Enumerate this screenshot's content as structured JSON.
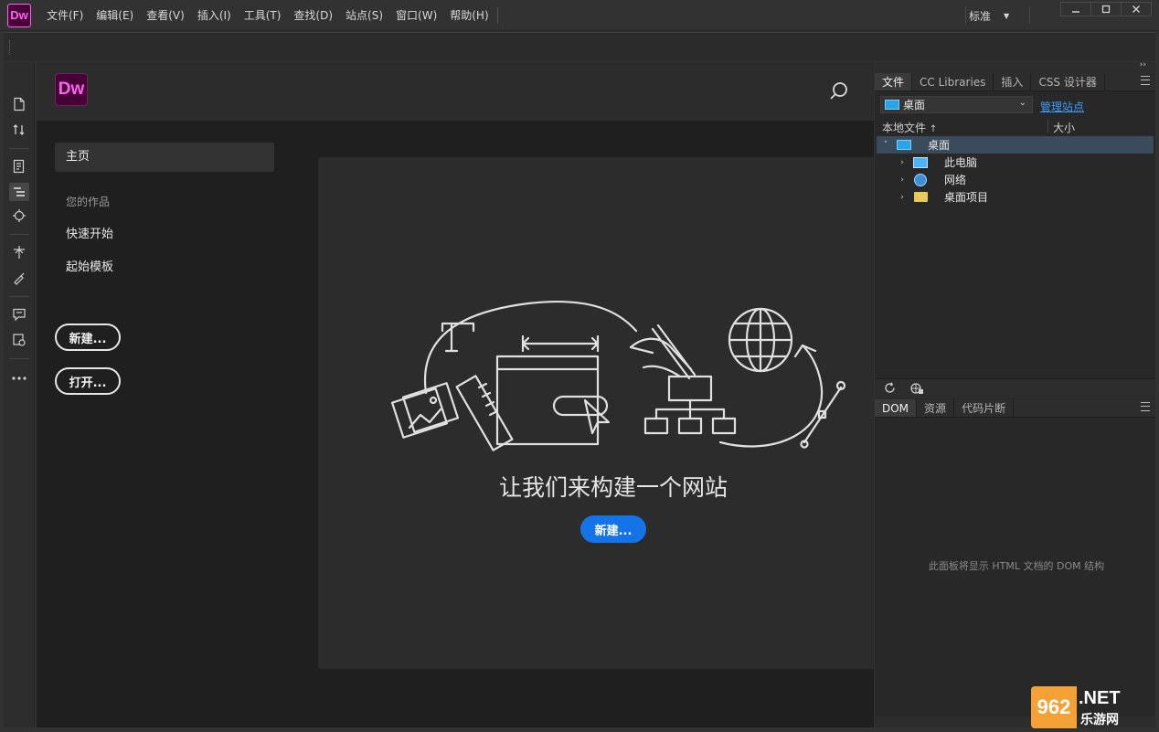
{
  "app": {
    "logo": "Dw",
    "brand_color": "#ff61f6",
    "accent": "#1473e6"
  },
  "menubar": {
    "items": [
      "文件(F)",
      "编辑(E)",
      "查看(V)",
      "插入(I)",
      "工具(T)",
      "查找(D)",
      "站点(S)",
      "窗口(W)",
      "帮助(H)"
    ],
    "workspace": "标准",
    "minimize": "▭",
    "maximize": "☐",
    "close": "✕"
  },
  "rail": {
    "icons": [
      "new-document-icon",
      "transfer-icon",
      "inspect-icon",
      "structure-icon",
      "target-icon",
      "expand-icon",
      "brush-icon",
      "comment-icon",
      "preview-icon",
      "more-icon"
    ]
  },
  "start": {
    "logo": "Dw",
    "nav": {
      "home": "主页",
      "section": "您的作品",
      "quick_start": "快速开始",
      "starter_templates": "起始模板"
    },
    "new_button": "新建...",
    "open_button": "打开...",
    "hero_title": "让我们来构建一个网站",
    "hero_button": "新建..."
  },
  "files_panel": {
    "tabs": [
      "文件",
      "CC Libraries",
      "插入",
      "CSS 设计器"
    ],
    "site": "桌面",
    "manage_sites": "管理站点",
    "col_local": "本地文件",
    "col_size": "大小",
    "tree": [
      {
        "label": "桌面",
        "arrow": "˅",
        "icon": "desktop-icon"
      },
      {
        "label": "此电脑",
        "arrow": "›",
        "icon": "computer-icon"
      },
      {
        "label": "网络",
        "arrow": "›",
        "icon": "network-icon"
      },
      {
        "label": "桌面项目",
        "arrow": "›",
        "icon": "folder-icon"
      }
    ]
  },
  "dom_panel": {
    "tabs": [
      "DOM",
      "资源",
      "代码片断"
    ],
    "message": "此面板将显示 HTML 文档的 DOM 结构"
  },
  "watermark": {
    "mark": "962",
    "net": ".NET",
    "sub": "乐游网"
  }
}
